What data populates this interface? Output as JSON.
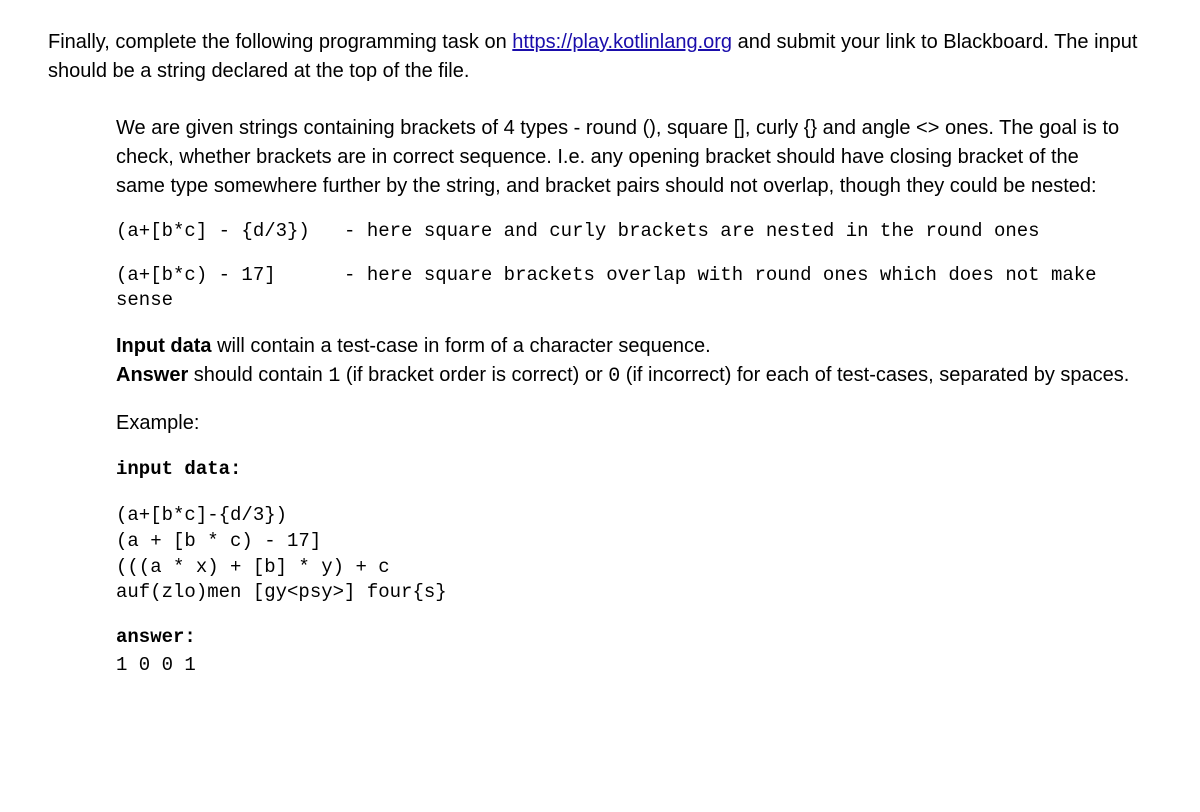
{
  "intro": {
    "before_link": "Finally, complete the following programming task on ",
    "link_text": "https://play.kotlinlang.org",
    "link_href": "https://play.kotlinlang.org",
    "after_link": " and submit your link to Blackboard. The input should be a string declared at the top of the file."
  },
  "task": {
    "description": "We are given strings containing brackets of 4 types - round (), square [], curly {} and angle <> ones. The goal is to check, whether brackets are in correct sequence. I.e. any opening bracket should have closing bracket of the same type somewhere further by the string, and bracket pairs should not overlap, though they could be nested:",
    "example1": "(a+[b*c] - {d/3})   - here square and curly brackets are nested in the round ones",
    "example2": "(a+[b*c) - 17]      - here square brackets overlap with round ones which does not make sense",
    "spec": {
      "input_label": "Input data",
      "input_rest": " will contain a test-case in form of a character sequence.",
      "answer_label": "Answer",
      "answer_rest_before": " should contain ",
      "code1": "1",
      "mid1": " (if bracket order is correct) or ",
      "code0": "0",
      "mid2": " (if incorrect) for each of test-cases, separated by spaces."
    },
    "example_heading": "Example:",
    "input_data_label": "input data:",
    "input_block": "(a+[b*c]-{d/3})\n(a + [b * c) - 17]\n(((a * x) + [b] * y) + c\nauf(zlo)men [gy<psy>] four{s}",
    "answer_heading": "answer:",
    "answer_value": "1 0 0 1"
  }
}
